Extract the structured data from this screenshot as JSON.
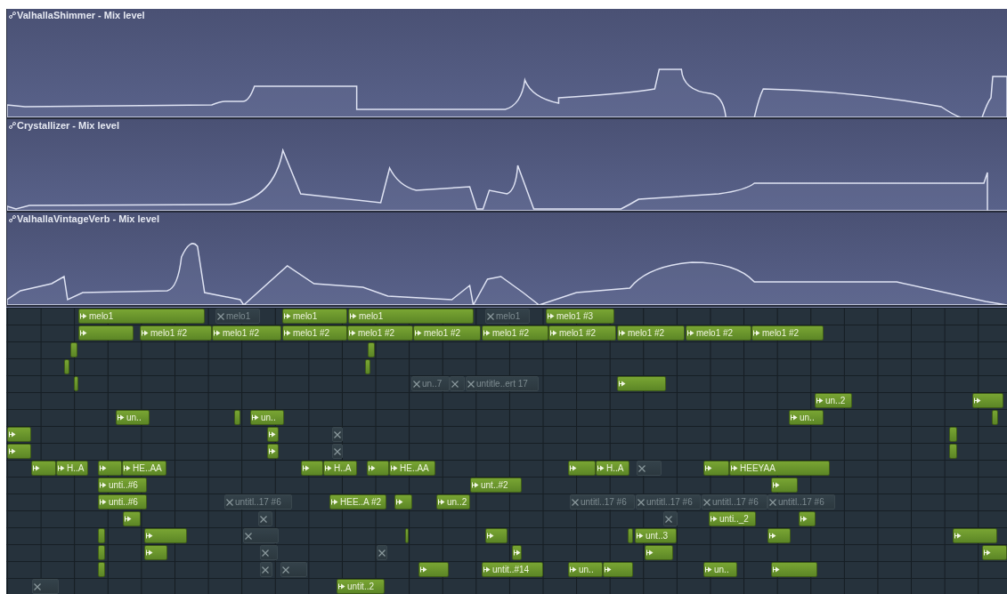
{
  "automation_lanes": [
    {
      "title": "ValhallaShimmer - Mix level"
    },
    {
      "title": "Crystallizer - Mix level"
    },
    {
      "title": "ValhallaVintageVerb - Mix level"
    }
  ],
  "clips": [
    {
      "label": "melo1",
      "muted": false
    },
    {
      "label": "melo1",
      "muted": true
    },
    {
      "label": "melo1",
      "muted": false
    },
    {
      "label": "melo1",
      "muted": false
    },
    {
      "label": "melo1",
      "muted": true
    },
    {
      "label": "melo1 #3",
      "muted": false
    },
    {
      "muted": false
    },
    {
      "label": "melo1 #2",
      "muted": false
    },
    {
      "label": "melo1 #2",
      "muted": false
    },
    {
      "label": "melo1 #2",
      "muted": false
    },
    {
      "label": "melo1 #2",
      "muted": false
    },
    {
      "label": "melo1 #2",
      "muted": false
    },
    {
      "label": "melo1 #2",
      "muted": false
    },
    {
      "label": "melo1 #2",
      "muted": false
    },
    {
      "label": "melo1 #2",
      "muted": false
    },
    {
      "label": "melo1 #2",
      "muted": false
    },
    {
      "label": "melo1 #2",
      "muted": false
    },
    {
      "muted": false
    },
    {
      "muted": false
    },
    {
      "muted": false
    },
    {
      "muted": false
    },
    {
      "muted": false
    },
    {
      "label": "un..7",
      "muted": true
    },
    {
      "muted": true
    },
    {
      "label": "untitle..ert 17",
      "muted": true
    },
    {
      "muted": false
    },
    {
      "label": "un..2",
      "muted": false
    },
    {
      "muted": false
    },
    {
      "label": "un..",
      "muted": false
    },
    {
      "muted": false
    },
    {
      "label": "un..",
      "muted": false
    },
    {
      "label": "un..",
      "muted": false
    },
    {
      "muted": false
    },
    {
      "muted": false
    },
    {
      "muted": false
    },
    {
      "muted": true
    },
    {
      "muted": false
    },
    {
      "muted": false
    },
    {
      "muted": false
    },
    {
      "muted": true
    },
    {
      "muted": false
    },
    {
      "muted": false
    },
    {
      "label": "H..A",
      "muted": false
    },
    {
      "muted": false
    },
    {
      "label": "HE..AA",
      "muted": false
    },
    {
      "muted": false
    },
    {
      "label": "H..A",
      "muted": false
    },
    {
      "muted": false
    },
    {
      "label": "HE..AA",
      "muted": false
    },
    {
      "muted": false
    },
    {
      "label": "H..A",
      "muted": false
    },
    {
      "muted": true
    },
    {
      "muted": false
    },
    {
      "label": "HEEYAA",
      "muted": false
    },
    {
      "label": "unti..#6",
      "muted": false
    },
    {
      "label": "unt..#2",
      "muted": false
    },
    {
      "muted": false
    },
    {
      "label": "unti..#6",
      "muted": false
    },
    {
      "label": "untitl..17 #6",
      "muted": true
    },
    {
      "label": "HEE..A #2",
      "muted": false
    },
    {
      "muted": false
    },
    {
      "label": "un..2",
      "muted": false
    },
    {
      "label": "untitl..17 #6",
      "muted": true
    },
    {
      "label": "untitl..17 #6",
      "muted": true
    },
    {
      "label": "untitl..17 #6",
      "muted": true
    },
    {
      "label": "untitl..17 #6",
      "muted": true
    },
    {
      "muted": false
    },
    {
      "muted": true
    },
    {
      "muted": true
    },
    {
      "label": "unti.._2",
      "muted": false
    },
    {
      "muted": false
    },
    {
      "muted": false
    },
    {
      "muted": false
    },
    {
      "muted": true
    },
    {
      "muted": false
    },
    {
      "muted": false
    },
    {
      "muted": false
    },
    {
      "label": "unt..3",
      "muted": false
    },
    {
      "muted": false
    },
    {
      "muted": false
    },
    {
      "muted": false
    },
    {
      "muted": false
    },
    {
      "muted": true
    },
    {
      "muted": true
    },
    {
      "muted": false
    },
    {
      "muted": false
    },
    {
      "muted": false
    },
    {
      "muted": false
    },
    {
      "muted": true
    },
    {
      "muted": true
    },
    {
      "muted": false
    },
    {
      "label": "untit..#14",
      "muted": false
    },
    {
      "label": "un..",
      "muted": false
    },
    {
      "muted": false
    },
    {
      "label": "un..",
      "muted": false
    },
    {
      "muted": false
    },
    {
      "muted": true
    },
    {
      "label": "untit..2",
      "muted": false
    }
  ]
}
